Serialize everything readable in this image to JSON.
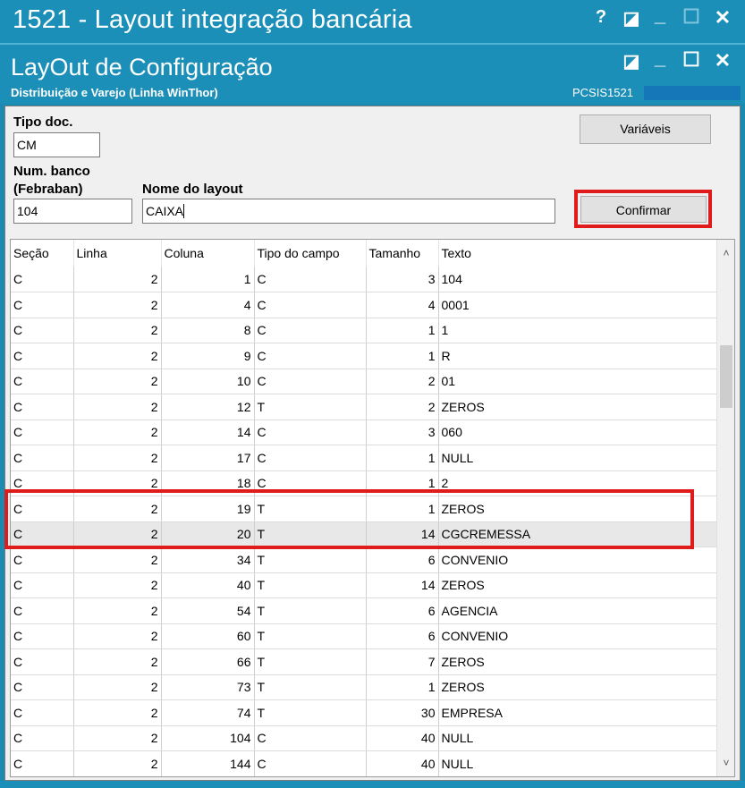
{
  "outer_window": {
    "title": "1521 - Layout integração bancária",
    "help": "?",
    "restore": "◪",
    "minimize": "_",
    "maximize": "☐",
    "close": "✕"
  },
  "inner_window": {
    "title": "LayOut de Configuração",
    "subtitle": "Distribuição e Varejo (Linha WinThor)",
    "code": "PCSIS1521",
    "restore": "◪",
    "minimize": "_",
    "maximize": "☐",
    "close": "✕"
  },
  "form": {
    "tipo_doc_label": "Tipo doc.",
    "tipo_doc_value": "CM",
    "num_banco_label_1": "Num. banco",
    "num_banco_label_2": "(Febraban)",
    "num_banco_value": "104",
    "nome_layout_label": "Nome do layout",
    "nome_layout_value": "CAIXA",
    "variaveis_button": "Variáveis",
    "confirmar_button": "Confirmar"
  },
  "grid": {
    "columns": [
      "Seção",
      "Linha",
      "Coluna",
      "Tipo do campo",
      "Tamanho",
      "Texto"
    ],
    "rows": [
      [
        "C",
        "2",
        "1",
        "C",
        "3",
        "104"
      ],
      [
        "C",
        "2",
        "4",
        "C",
        "4",
        "0001"
      ],
      [
        "C",
        "2",
        "8",
        "C",
        "1",
        "1"
      ],
      [
        "C",
        "2",
        "9",
        "C",
        "1",
        "R"
      ],
      [
        "C",
        "2",
        "10",
        "C",
        "2",
        "01"
      ],
      [
        "C",
        "2",
        "12",
        "T",
        "2",
        "ZEROS"
      ],
      [
        "C",
        "2",
        "14",
        "C",
        "3",
        "060"
      ],
      [
        "C",
        "2",
        "17",
        "C",
        "1",
        "NULL"
      ],
      [
        "C",
        "2",
        "18",
        "C",
        "1",
        "2"
      ],
      [
        "C",
        "2",
        "19",
        "T",
        "1",
        "ZEROS"
      ],
      [
        "C",
        "2",
        "20",
        "T",
        "14",
        "CGCREMESSA"
      ],
      [
        "C",
        "2",
        "34",
        "T",
        "6",
        "CONVENIO"
      ],
      [
        "C",
        "2",
        "40",
        "T",
        "14",
        "ZEROS"
      ],
      [
        "C",
        "2",
        "54",
        "T",
        "6",
        "AGENCIA"
      ],
      [
        "C",
        "2",
        "60",
        "T",
        "6",
        "CONVENIO"
      ],
      [
        "C",
        "2",
        "66",
        "T",
        "7",
        "ZEROS"
      ],
      [
        "C",
        "2",
        "73",
        "T",
        "1",
        "ZEROS"
      ],
      [
        "C",
        "2",
        "74",
        "T",
        "30",
        "EMPRESA"
      ],
      [
        "C",
        "2",
        "104",
        "C",
        "40",
        "NULL"
      ],
      [
        "C",
        "2",
        "144",
        "C",
        "40",
        "NULL"
      ]
    ],
    "selected_row": 10,
    "scroll_up": "˄",
    "scroll_down": "˅"
  },
  "colors": {
    "titlebar": "#1c8fb8",
    "highlight": "#e01b1b"
  }
}
